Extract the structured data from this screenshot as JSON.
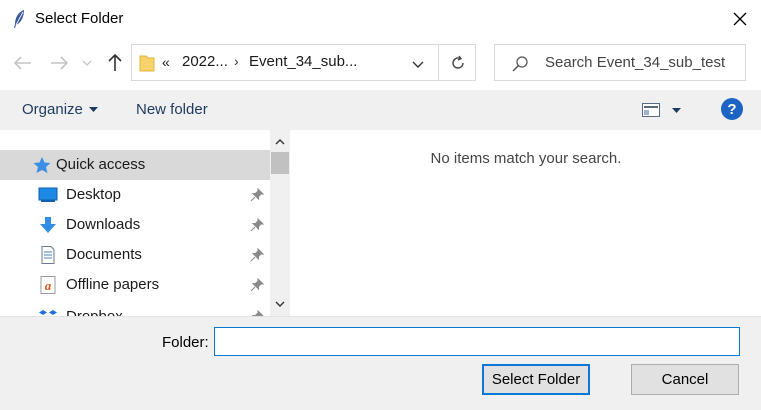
{
  "window": {
    "title": "Select Folder",
    "icon": "feather-icon"
  },
  "navigation": {
    "breadcrumb_overflow": "«",
    "breadcrumb_parent": "2022...",
    "breadcrumb_separator": "›",
    "breadcrumb_current": "Event_34_sub..."
  },
  "search": {
    "placeholder": "Search Event_34_sub_test"
  },
  "toolbar": {
    "organize_label": "Organize",
    "new_folder_label": "New folder",
    "help_label": "?"
  },
  "sidebar": {
    "items": [
      {
        "label": "Quick access",
        "icon": "star-icon",
        "selected": true
      },
      {
        "label": "Desktop",
        "icon": "desktop-icon",
        "pinned": true
      },
      {
        "label": "Downloads",
        "icon": "download-arrow-icon",
        "pinned": true
      },
      {
        "label": "Documents",
        "icon": "document-icon",
        "pinned": true
      },
      {
        "label": "Offline papers",
        "icon": "app-icon",
        "pinned": true
      },
      {
        "label": "Dropbox",
        "icon": "dropbox-icon",
        "pinned": true
      }
    ]
  },
  "content": {
    "empty_message": "No items match your search."
  },
  "footer": {
    "folder_label": "Folder:",
    "folder_value": "",
    "select_button": "Select Folder",
    "cancel_button": "Cancel"
  },
  "colors": {
    "accent": "#0a78d7",
    "selection": "#d9d9d9",
    "help": "#1c63c3"
  }
}
